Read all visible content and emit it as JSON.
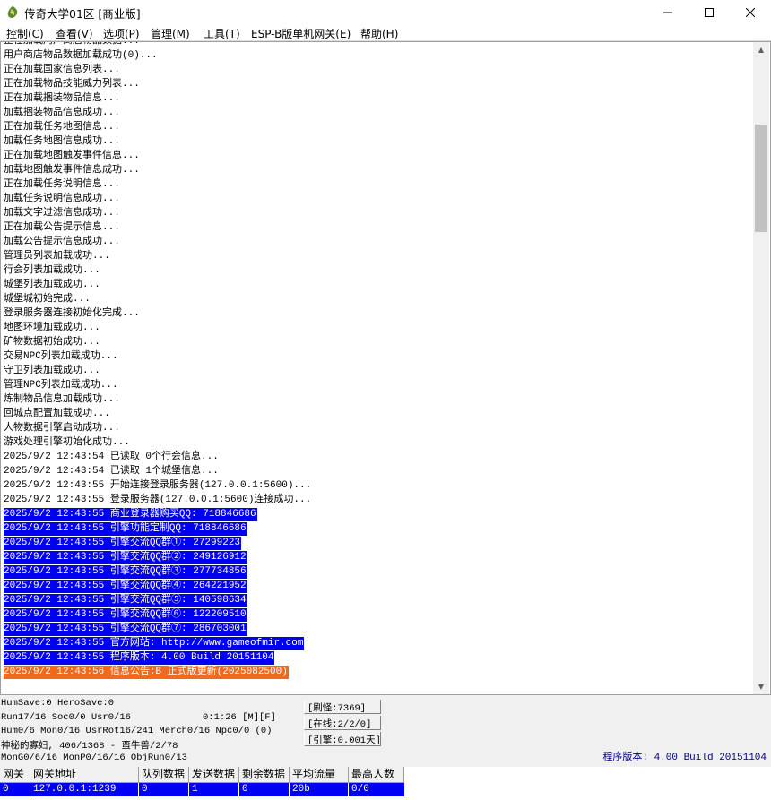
{
  "window": {
    "title": "传奇大学01区 [商业版]",
    "minimize": "—",
    "maximize": "☐",
    "close": "✕"
  },
  "menu": [
    "控制(C)",
    "查看(V)",
    "选项(P)",
    "管理(M)",
    "工具(T)",
    "ESP-B版单机网关(E)",
    "帮助(H)"
  ],
  "log": [
    {
      "text": "正在加载用户商店物品数据..."
    },
    {
      "text": "用户商店物品数据加载成功(0)..."
    },
    {
      "text": "正在加载国家信息列表..."
    },
    {
      "text": "正在加载物品技能威力列表..."
    },
    {
      "text": "正在加载捆装物品信息..."
    },
    {
      "text": "加载捆装物品信息成功..."
    },
    {
      "text": "正在加载任务地图信息..."
    },
    {
      "text": "加载任务地图信息成功..."
    },
    {
      "text": "正在加载地图触发事件信息..."
    },
    {
      "text": "加载地图触发事件信息成功..."
    },
    {
      "text": "正在加载任务说明信息..."
    },
    {
      "text": "加载任务说明信息成功..."
    },
    {
      "text": "加载文字过滤信息成功..."
    },
    {
      "text": "正在加载公告提示信息..."
    },
    {
      "text": "加载公告提示信息成功..."
    },
    {
      "text": "管理员列表加载成功..."
    },
    {
      "text": "行会列表加载成功..."
    },
    {
      "text": "城堡列表加载成功..."
    },
    {
      "text": "城堡城初始完成..."
    },
    {
      "text": "登录服务器连接初始化完成..."
    },
    {
      "text": "地图环境加载成功..."
    },
    {
      "text": "矿物数据初始成功..."
    },
    {
      "text": "交易NPC列表加载成功..."
    },
    {
      "text": "守卫列表加载成功..."
    },
    {
      "text": "管理NPC列表加载成功..."
    },
    {
      "text": "炼制物品信息加载成功..."
    },
    {
      "text": "回城点配置加载成功..."
    },
    {
      "text": "人物数据引擎启动成功..."
    },
    {
      "text": "游戏处理引擎初始化成功..."
    },
    {
      "text": "2025/9/2 12:43:54 已读取 0个行会信息..."
    },
    {
      "text": "2025/9/2 12:43:54 已读取 1个城堡信息..."
    },
    {
      "text": "2025/9/2 12:43:55 开始连接登录服务器(127.0.0.1:5600)..."
    },
    {
      "text": "2025/9/2 12:43:55 登录服务器(127.0.0.1:5600)连接成功..."
    },
    {
      "text": "2025/9/2 12:43:55 商业登录器购买QQ: 718846686",
      "style": "blue"
    },
    {
      "text": "2025/9/2 12:43:55 引擎功能定制QQ: 718846686",
      "style": "blue"
    },
    {
      "text": "2025/9/2 12:43:55 引擎交流QQ群①: 27299223",
      "style": "blue"
    },
    {
      "text": "2025/9/2 12:43:55 引擎交流QQ群②: 249126912",
      "style": "blue"
    },
    {
      "text": "2025/9/2 12:43:55 引擎交流QQ群③: 277734856",
      "style": "blue"
    },
    {
      "text": "2025/9/2 12:43:55 引擎交流QQ群④: 264221952",
      "style": "blue"
    },
    {
      "text": "2025/9/2 12:43:55 引擎交流QQ群⑤: 140598634",
      "style": "blue"
    },
    {
      "text": "2025/9/2 12:43:55 引擎交流QQ群⑥: 122209510",
      "style": "blue"
    },
    {
      "text": "2025/9/2 12:43:55 引擎交流QQ群⑦: 286703001",
      "style": "blue"
    },
    {
      "text": "2025/9/2 12:43:55 官方网站: http://www.gameofmir.com",
      "style": "blue"
    },
    {
      "text": "2025/9/2 12:43:55 程序版本: 4.00 Build 20151104",
      "style": "blue"
    },
    {
      "text": "2025/9/2 12:43:56 信息公告:B 正式版更新(2025082500)",
      "style": "orange"
    }
  ],
  "status": {
    "line1": "HumSave:0 HeroSave:0",
    "line2": "Run17/16 Soc0/0 Usr0/16",
    "line2_time": "0:1:26 [M][F]",
    "line3": "Hum0/6 Mon0/16 UsrRot16/241 Merch0/16 Npc0/0 (0)",
    "line4": "神秘的寡妇, 406/1368 - 蛮牛兽/2/78",
    "line5": "MonG0/6/16 MonP0/16/16 ObjRun0/13",
    "refresh": "[刷怪:7369]",
    "online": "[在线:2/2/0]",
    "engine": "[引擎:0.001天]",
    "build": "程序版本: 4.00 Build 20151104"
  },
  "gateway": {
    "headers": [
      "网关",
      "网关地址",
      "队列数据",
      "发送数据",
      "剩余数据",
      "平均流量",
      "最高人数"
    ],
    "row": [
      "0",
      "127.0.0.1:1239",
      "0",
      "1",
      "0",
      "20b",
      "0/0"
    ]
  }
}
